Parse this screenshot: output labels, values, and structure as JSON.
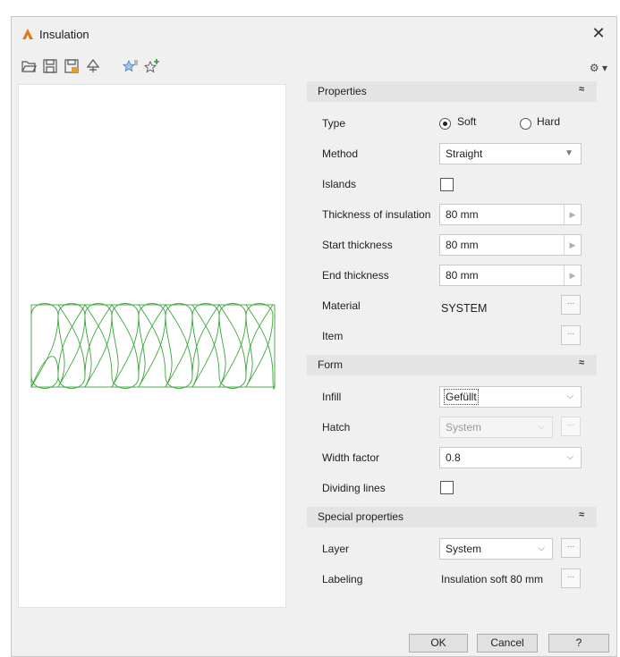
{
  "window": {
    "title": "Insulation",
    "close_glyph": "✕"
  },
  "toolbar": {
    "icons": [
      "open-folder-icon",
      "save-icon",
      "save-as-icon",
      "filter-icon",
      "favorites-icon",
      "add-favorite-icon"
    ],
    "settings_glyph": "⚙ ▾"
  },
  "sections": {
    "properties": {
      "label": "Properties",
      "collapse_glyph": "≈"
    },
    "form": {
      "label": "Form",
      "collapse_glyph": "≈"
    },
    "special": {
      "label": "Special properties",
      "collapse_glyph": "≈"
    }
  },
  "properties": {
    "type": {
      "label": "Type",
      "options": [
        "Soft",
        "Hard"
      ],
      "selected": "Soft"
    },
    "method": {
      "label": "Method",
      "value": "Straight"
    },
    "islands": {
      "label": "Islands",
      "checked": false
    },
    "thickness": {
      "label": "Thickness of insulation",
      "value": "80 mm"
    },
    "start_thickness": {
      "label": "Start thickness",
      "value": "80 mm"
    },
    "end_thickness": {
      "label": "End thickness",
      "value": "80 mm"
    },
    "material": {
      "label": "Material",
      "value": "SYSTEM"
    },
    "item": {
      "label": "Item"
    }
  },
  "form": {
    "infill": {
      "label": "Infill",
      "value": "Gefüllt"
    },
    "hatch": {
      "label": "Hatch",
      "value": "System"
    },
    "width_factor": {
      "label": "Width factor",
      "value": "0.8"
    },
    "dividing_lines": {
      "label": "Dividing lines",
      "checked": false
    }
  },
  "special": {
    "layer": {
      "label": "Layer",
      "value": "System"
    },
    "labeling": {
      "label": "Labeling",
      "value": "Insulation soft 80 mm"
    }
  },
  "buttons": {
    "ok": "OK",
    "cancel": "Cancel",
    "help": "?",
    "ellipsis": "..."
  },
  "colors": {
    "preview_stroke": "#3aa63a",
    "accent": "#e07b1a"
  }
}
